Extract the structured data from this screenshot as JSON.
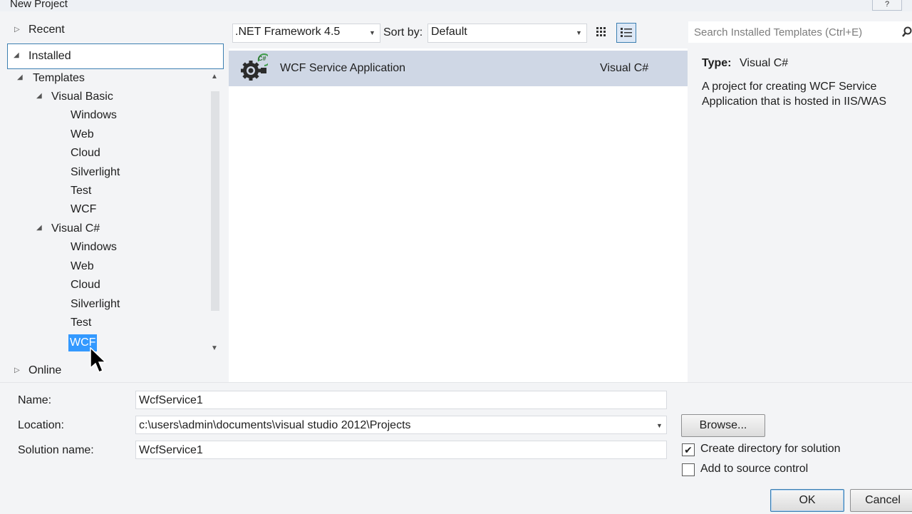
{
  "window": {
    "title": "New Project",
    "help_label": "?"
  },
  "nav": {
    "recent": "Recent",
    "installed": "Installed",
    "online": "Online",
    "templates_root": "Templates",
    "groups": [
      {
        "label": "Visual Basic",
        "items": [
          "Windows",
          "Web",
          "Cloud",
          "Silverlight",
          "Test",
          "WCF"
        ]
      },
      {
        "label": "Visual C#",
        "items": [
          "Windows",
          "Web",
          "Cloud",
          "Silverlight",
          "Test",
          "WCF"
        ]
      }
    ],
    "selected": "WCF"
  },
  "toolbar": {
    "framework": ".NET Framework 4.5",
    "sort_label": "Sort by:",
    "sort_value": "Default"
  },
  "search": {
    "placeholder": "Search Installed Templates (Ctrl+E)"
  },
  "templates": [
    {
      "name": "WCF Service Application",
      "language": "Visual C#",
      "icon_badge": "C#"
    }
  ],
  "details": {
    "type_label": "Type:",
    "type_value": "Visual C#",
    "description": "A project for creating WCF Service Application that is hosted in IIS/WAS"
  },
  "form": {
    "name_label": "Name:",
    "name_value": "WcfService1",
    "location_label": "Location:",
    "location_value": "c:\\users\\admin\\documents\\visual studio 2012\\Projects",
    "solution_label": "Solution name:",
    "solution_value": "WcfService1",
    "browse_label": "Browse...",
    "create_dir_label": "Create directory for solution",
    "create_dir_checked": true,
    "source_control_label": "Add to source control",
    "source_control_checked": false,
    "ok_label": "OK",
    "cancel_label": "Cancel"
  },
  "colors": {
    "selection": "#3399ff",
    "template_highlight": "#cfd7e5",
    "focus_border": "#3c7fb1"
  }
}
